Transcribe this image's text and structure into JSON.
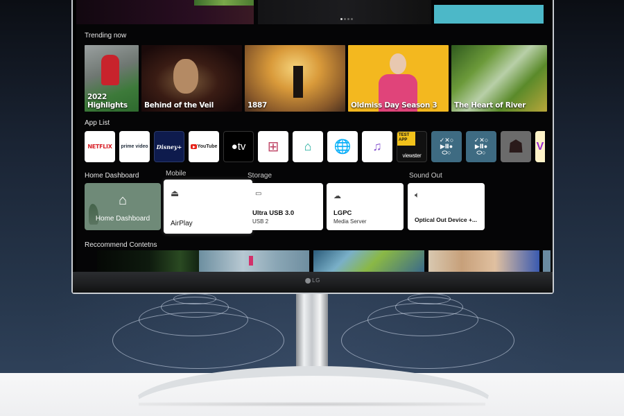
{
  "hero": {
    "page_indicator": {
      "total": 4,
      "active": 1
    }
  },
  "sections": {
    "trending": "Trending now",
    "apps": "App List",
    "home_dashboard": "Home Dashboard",
    "mobile": "Mobile",
    "storage": "Storage",
    "sound_out": "Sound Out",
    "recommended": "Reccommend Contetns"
  },
  "trending": [
    {
      "title": "2022\nHighlights",
      "line1": "2022",
      "line2": "Highlights"
    },
    {
      "title": "Behind of the Veil"
    },
    {
      "title": "1887"
    },
    {
      "title": "Oldmiss Day Season 3"
    },
    {
      "title": "The Heart of River"
    }
  ],
  "apps": [
    {
      "name": "Netflix",
      "label": "NETFLIX"
    },
    {
      "name": "Prime Video",
      "label": "prime video"
    },
    {
      "name": "Disney+",
      "label": "Disney+"
    },
    {
      "name": "YouTube",
      "label": "YouTube"
    },
    {
      "name": "Apple TV",
      "label": "tv",
      "display": "tv"
    },
    {
      "name": "Apps",
      "icon": "grid-icon",
      "label": "⊞"
    },
    {
      "name": "Home",
      "icon": "home-hub-icon",
      "label": "⌂"
    },
    {
      "name": "Web Browser",
      "icon": "globe-icon",
      "label": "🌐"
    },
    {
      "name": "Media Player",
      "icon": "media-icon",
      "label": "♫"
    },
    {
      "name": "Viewster",
      "badge": "TEST\nAPP",
      "badge_l1": "TEST",
      "badge_l2": "APP",
      "label": "viewster"
    },
    {
      "name": "Game Controller",
      "label": "✓✕○\n▶Ⅱ●\n⬭○"
    },
    {
      "name": "Game Controller",
      "label": "✓✕○\n▶Ⅱ●\n⬭○"
    },
    {
      "name": "Mystery App",
      "label": "☗"
    },
    {
      "name": "Partial App",
      "label": "V"
    }
  ],
  "dashboard": {
    "home": {
      "title": "Home Dashboard"
    },
    "mobile": {
      "title": "AirPlay"
    },
    "storage": {
      "title": "Ultra USB 3.0",
      "subtitle": "USB 2"
    },
    "server": {
      "title": "LGPC",
      "subtitle": "Media Server"
    },
    "sound": {
      "title": "Optical Out Device +..."
    }
  },
  "brand": {
    "logo": "LG"
  }
}
